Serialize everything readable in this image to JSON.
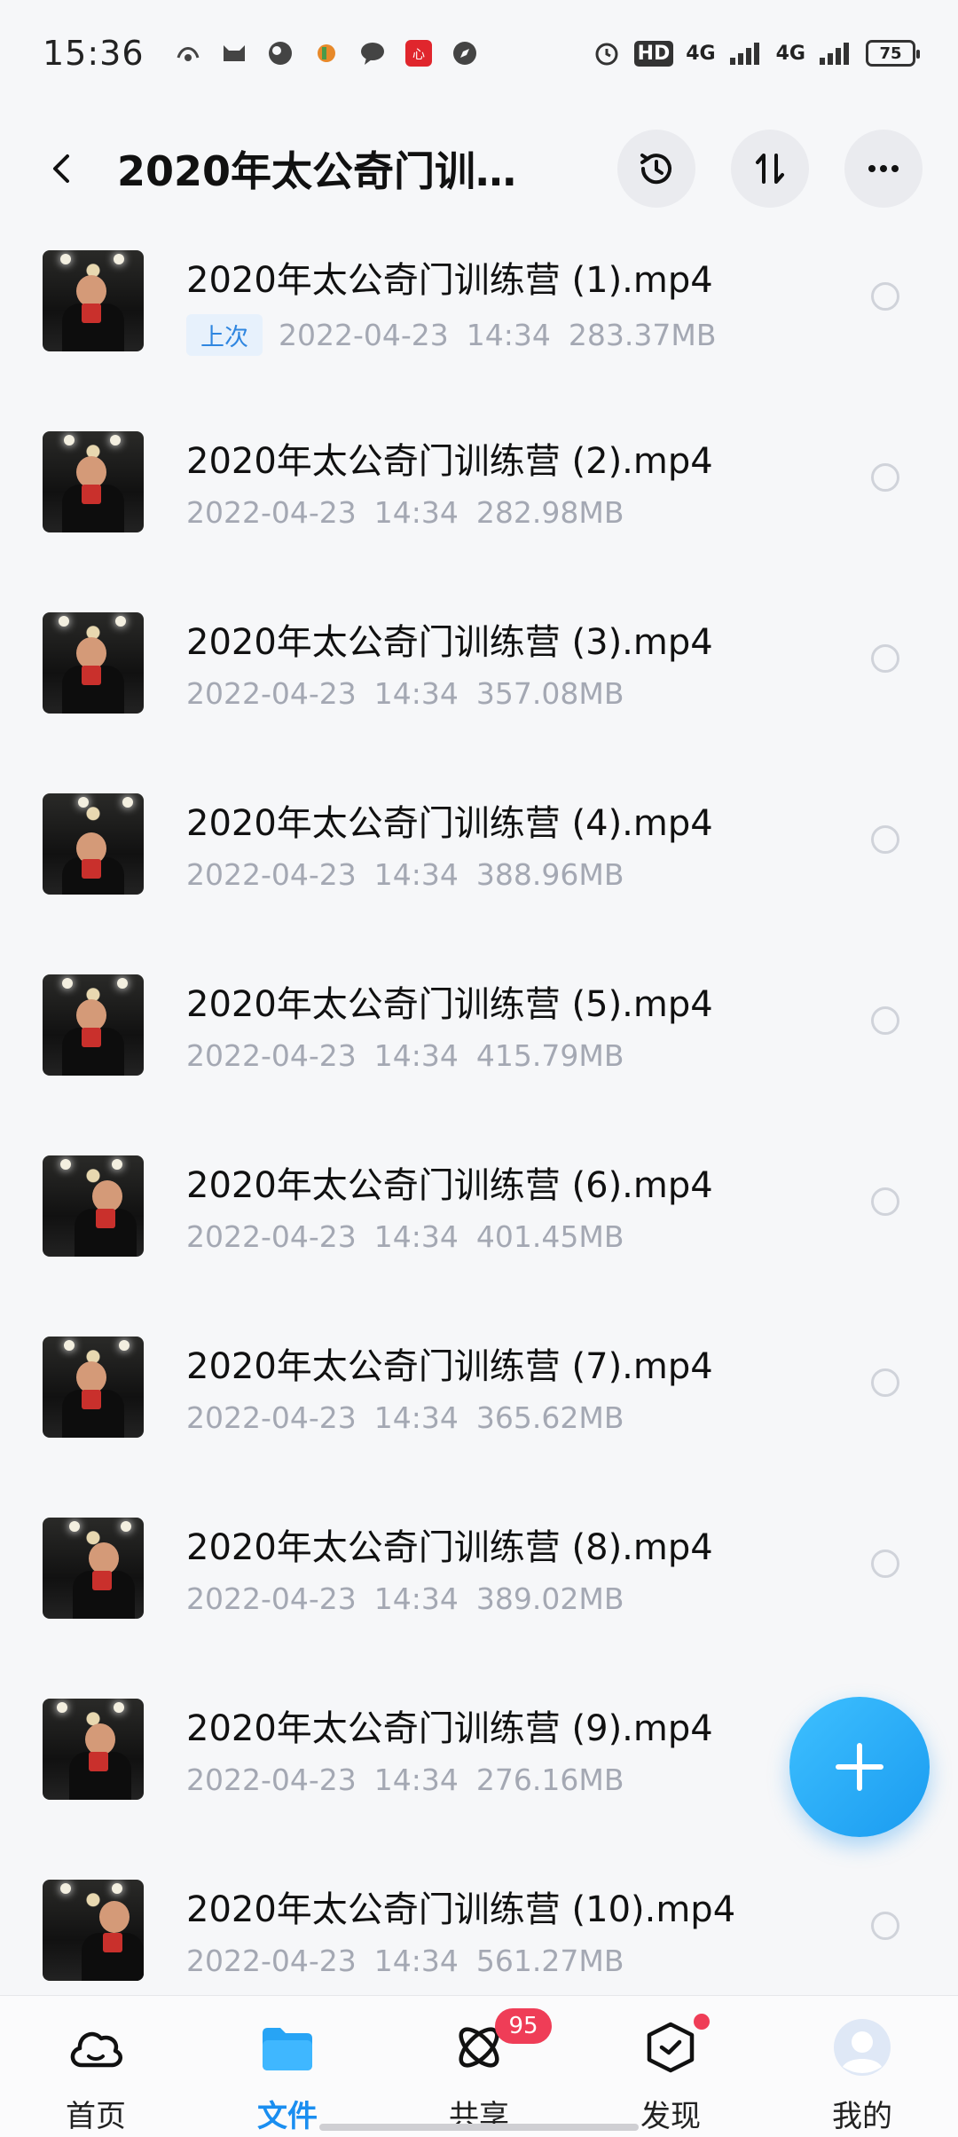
{
  "status_bar": {
    "time": "15:36",
    "battery": "75",
    "network_1": "4G",
    "network_2": "4G",
    "hd": "HD"
  },
  "header": {
    "title": "2020年太公奇门训…",
    "icons": [
      "back-icon",
      "history-icon",
      "sort-icon",
      "more-icon"
    ]
  },
  "files": [
    {
      "name": "2020年太公奇门训练营 (1).mp4",
      "tag": "上次",
      "date": "2022-04-23",
      "time": "14:34",
      "size": "283.37MB"
    },
    {
      "name": "2020年太公奇门训练营 (2).mp4",
      "tag": "",
      "date": "2022-04-23",
      "time": "14:34",
      "size": "282.98MB"
    },
    {
      "name": "2020年太公奇门训练营 (3).mp4",
      "tag": "",
      "date": "2022-04-23",
      "time": "14:34",
      "size": "357.08MB"
    },
    {
      "name": "2020年太公奇门训练营 (4).mp4",
      "tag": "",
      "date": "2022-04-23",
      "time": "14:34",
      "size": "388.96MB"
    },
    {
      "name": "2020年太公奇门训练营 (5).mp4",
      "tag": "",
      "date": "2022-04-23",
      "time": "14:34",
      "size": "415.79MB"
    },
    {
      "name": "2020年太公奇门训练营 (6).mp4",
      "tag": "",
      "date": "2022-04-23",
      "time": "14:34",
      "size": "401.45MB"
    },
    {
      "name": "2020年太公奇门训练营 (7).mp4",
      "tag": "",
      "date": "2022-04-23",
      "time": "14:34",
      "size": "365.62MB"
    },
    {
      "name": "2020年太公奇门训练营 (8).mp4",
      "tag": "",
      "date": "2022-04-23",
      "time": "14:34",
      "size": "389.02MB"
    },
    {
      "name": "2020年太公奇门训练营 (9).mp4",
      "tag": "",
      "date": "2022-04-23",
      "time": "14:34",
      "size": "276.16MB"
    },
    {
      "name": "2020年太公奇门训练营 (10).mp4",
      "tag": "",
      "date": "2022-04-23",
      "time": "14:34",
      "size": "561.27MB"
    }
  ],
  "bottom_nav": [
    {
      "label": "首页",
      "icon": "cloud-home-icon",
      "active": false
    },
    {
      "label": "文件",
      "icon": "folder-icon",
      "active": true
    },
    {
      "label": "共享",
      "icon": "share-atom-icon",
      "active": false,
      "badge": "95"
    },
    {
      "label": "发现",
      "icon": "discover-box-icon",
      "active": false,
      "dot": true
    },
    {
      "label": "我的",
      "icon": "avatar-icon",
      "active": false
    }
  ],
  "colors": {
    "accent": "#1a8ef0",
    "badge": "#ef3d57",
    "meta_text": "#a4a8b3"
  }
}
